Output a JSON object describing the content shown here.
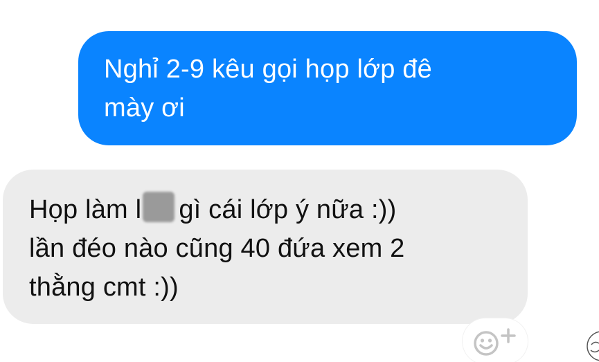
{
  "messages": {
    "outgoing": {
      "line1": "Nghỉ 2-9 kêu gọi họp lớp đê",
      "line2": "mày ơi"
    },
    "incoming": {
      "line1_before": "Họp làm l",
      "line1_after": "gì cái lớp ý nữa :))",
      "line2": "lần đéo nào cũng 40 đứa xem 2",
      "line3": "thằng cmt :))"
    }
  },
  "reaction_button": {
    "icon": "emoji-add-icon"
  },
  "colors": {
    "outgoing_bubble": "#0a84ff",
    "incoming_bubble": "#ececec"
  }
}
